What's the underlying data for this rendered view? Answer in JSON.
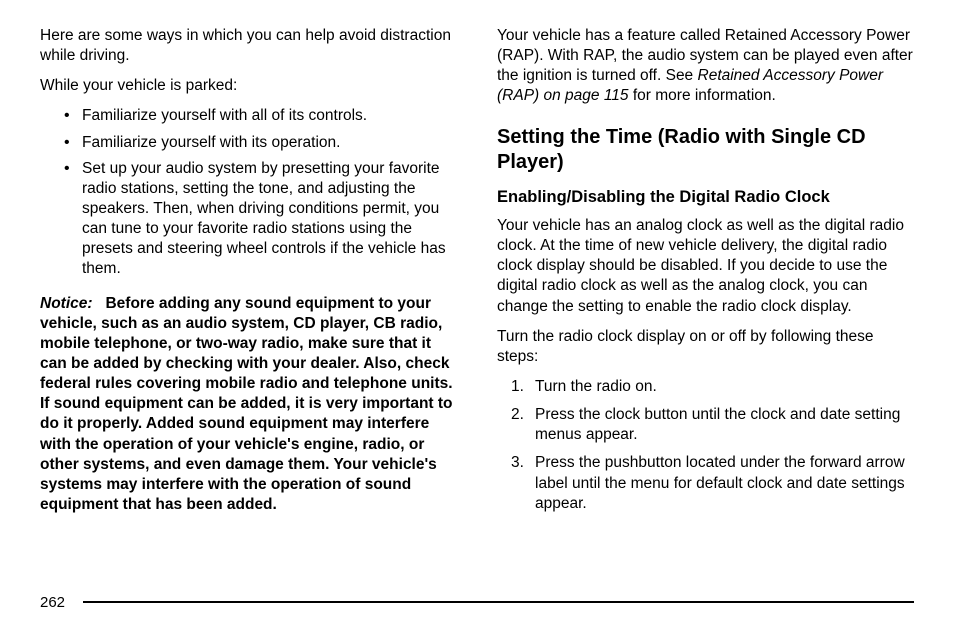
{
  "left": {
    "intro1": "Here are some ways in which you can help avoid distraction while driving.",
    "intro2": "While your vehicle is parked:",
    "bullets": [
      "Familiarize yourself with all of its controls.",
      "Familiarize yourself with its operation.",
      "Set up your audio system by presetting your favorite radio stations, setting the tone, and adjusting the speakers. Then, when driving conditions permit, you can tune to your favorite radio stations using the presets and steering wheel controls if the vehicle has them."
    ],
    "notice_label": "Notice:",
    "notice_text": "Before adding any sound equipment to your vehicle, such as an audio system, CD player, CB radio, mobile telephone, or two-way radio, make sure that it can be added by checking with your dealer. Also, check federal rules covering mobile radio and telephone units. If sound equipment can be added, it is very important to do it properly. Added sound equipment may interfere with the operation of your vehicle's engine, radio, or other systems, and even damage them. Your vehicle's systems may interfere with the operation of sound equipment that has been added."
  },
  "right": {
    "rap_p1a": "Your vehicle has a feature called Retained Accessory Power (RAP). With RAP, the audio system can be played even after the ignition is turned off. See ",
    "rap_ref": "Retained Accessory Power (RAP) on page 115",
    "rap_p1b": " for more information.",
    "h2": "Setting the Time (Radio with Single CD Player)",
    "h3": "Enabling/Disabling the Digital Radio Clock",
    "p2": "Your vehicle has an analog clock as well as the digital radio clock. At the time of new vehicle delivery, the digital radio clock display should be disabled. If you decide to use the digital radio clock as well as the analog clock, you can change the setting to enable the radio clock display.",
    "p3": "Turn the radio clock display on or off by following these steps:",
    "steps": [
      "Turn the radio on.",
      "Press the clock button until the clock and date setting menus appear.",
      "Press the pushbutton located under the forward arrow label until the menu for default clock and date settings appear."
    ]
  },
  "page_number": "262"
}
